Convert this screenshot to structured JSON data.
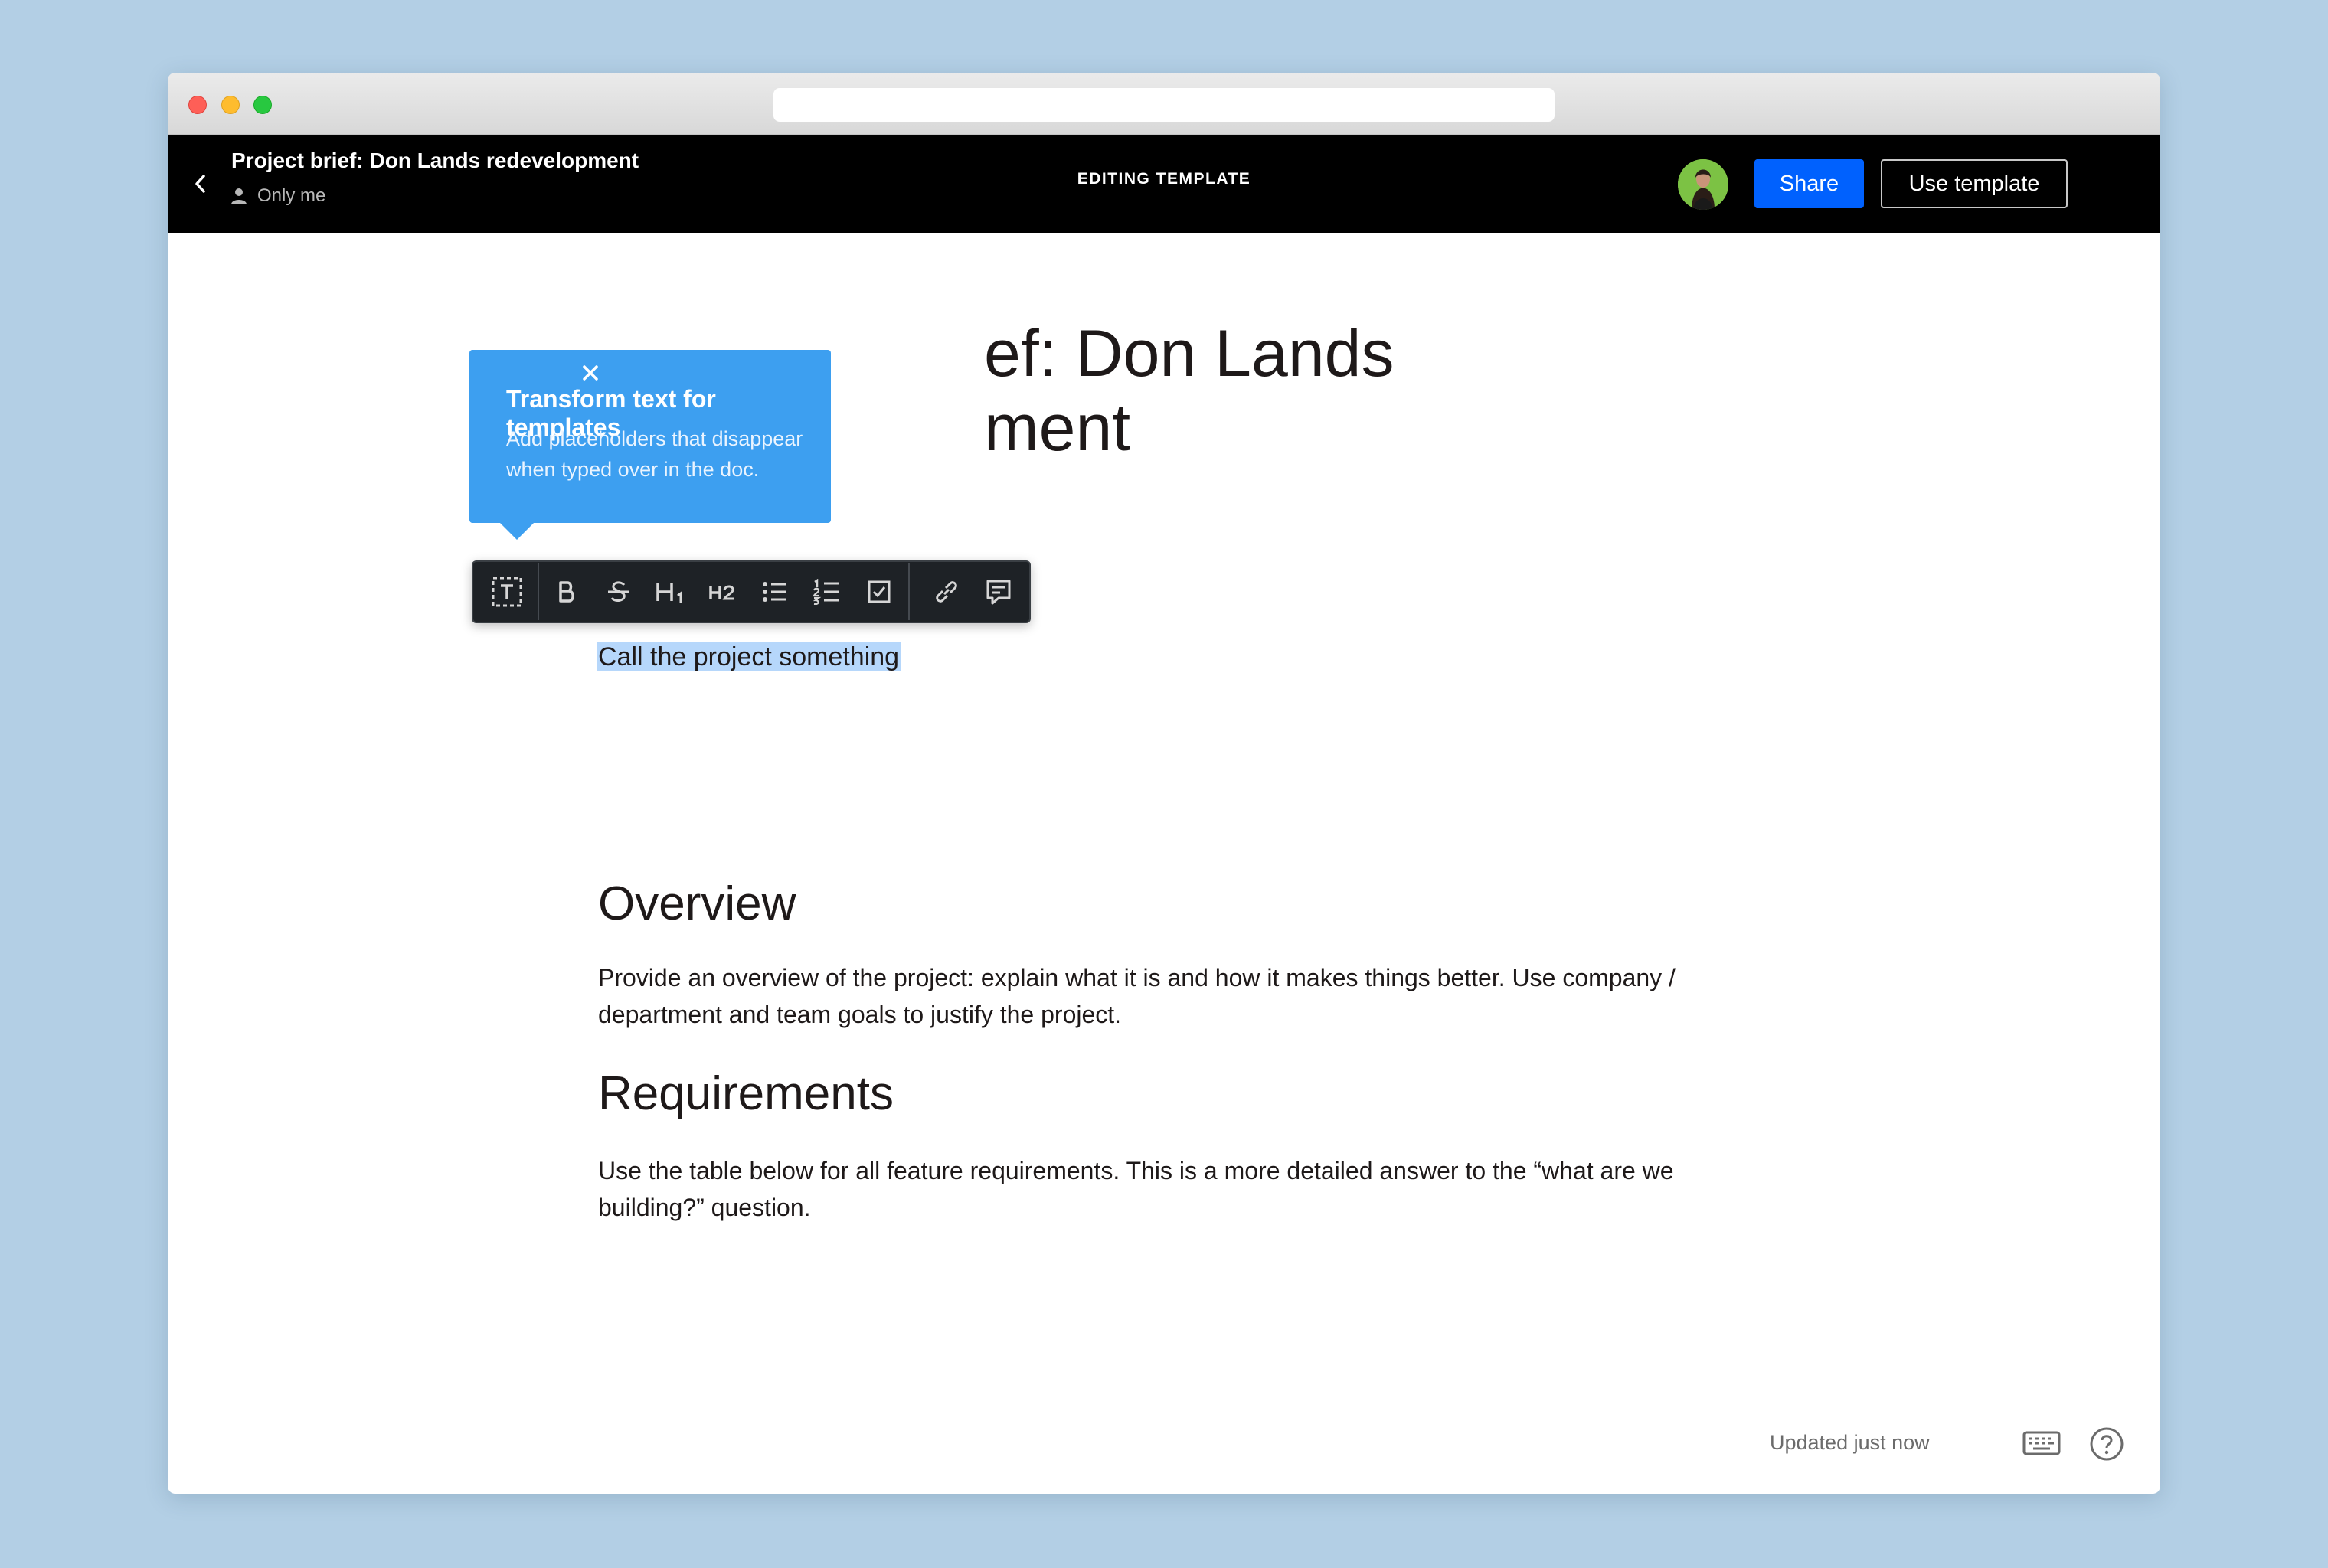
{
  "window": {
    "url": ""
  },
  "appbar": {
    "doc_title": "Project brief: Don Lands redevelopment",
    "sharing": "Only me",
    "mode_label": "EDITING TEMPLATE",
    "share_label": "Share",
    "use_template_label": "Use template",
    "icons": {
      "back": "chevron-left-icon",
      "sharing": "person-icon",
      "more": "more-dots-icon"
    },
    "colors": {
      "share_button": "#0061fe",
      "avatar_bg": "#7cc244"
    }
  },
  "document": {
    "title_visible_line1": "ef: Don Lands",
    "title_visible_line2": "ment",
    "title_line1": "Project brief: Don Lands",
    "title_line2": "redevelopment",
    "placeholder": "Call the project something",
    "sections": [
      {
        "heading": "Overview",
        "body": "Provide an overview of the project: explain what it is and how it makes things better. Use company / department and team goals to justify the project."
      },
      {
        "heading": "Requirements",
        "body": "Use the table below for all feature requirements. This is a more detailed answer to the “what are we building?” question."
      }
    ]
  },
  "tooltip": {
    "title": "Transform text for templates",
    "body": "Add placeholders that disappear when typed over in the doc.",
    "color": "#3d9ff0"
  },
  "format_toolbar": {
    "buttons": [
      "placeholder-text-icon",
      "bold-icon",
      "strikethrough-icon",
      "heading-1-icon",
      "heading-2-icon",
      "bulleted-list-icon",
      "numbered-list-icon",
      "checkbox-icon",
      "link-icon",
      "comment-icon"
    ]
  },
  "footer": {
    "status": "Updated just now",
    "icons": [
      "keyboard-icon",
      "help-icon"
    ]
  }
}
